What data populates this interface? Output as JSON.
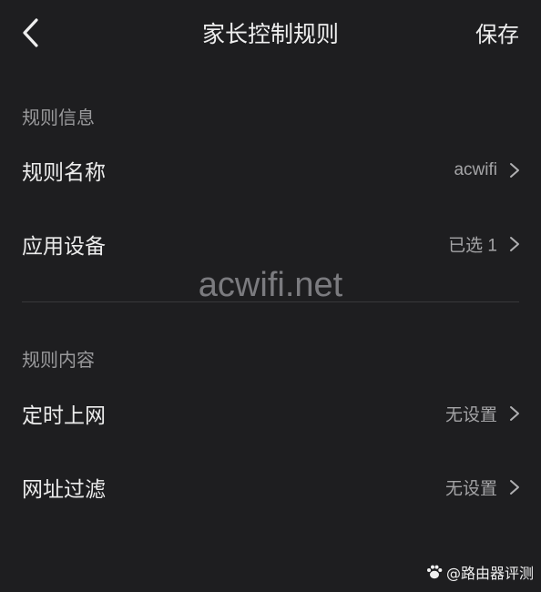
{
  "header": {
    "title": "家长控制规则",
    "save_label": "保存"
  },
  "sections": {
    "rule_info": {
      "title": "规则信息",
      "rule_name": {
        "label": "规则名称",
        "value": "acwifi"
      },
      "applied_devices": {
        "label": "应用设备",
        "value": "已选 1"
      }
    },
    "rule_content": {
      "title": "规则内容",
      "scheduled_access": {
        "label": "定时上网",
        "value": "无设置"
      },
      "url_filter": {
        "label": "网址过滤",
        "value": "无设置"
      }
    }
  },
  "watermark": "acwifi.net",
  "source_badge": "@路由器评测",
  "colors": {
    "background": "#1e1e20",
    "text_primary": "#ececec",
    "text_secondary": "#a4a4a6",
    "section_title": "#9a9a9c"
  }
}
